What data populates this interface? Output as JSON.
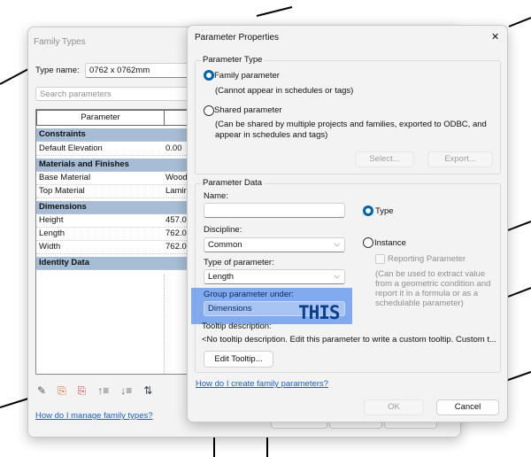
{
  "family_types": {
    "title": "Family Types",
    "type_name_label": "Type name:",
    "type_name_value": "0762 x 0762mm",
    "search_placeholder": "Search parameters",
    "column_header": "Parameter",
    "rows": [
      {
        "kind": "section",
        "label": "Constraints"
      },
      {
        "kind": "param",
        "label": "Default Elevation",
        "value": "0.00"
      },
      {
        "kind": "section",
        "label": "Materials and Finishes"
      },
      {
        "kind": "param",
        "label": "Base Material",
        "value": "Wood"
      },
      {
        "kind": "param",
        "label": "Top Material",
        "value": "Lamin"
      },
      {
        "kind": "section",
        "label": "Dimensions"
      },
      {
        "kind": "param",
        "label": "Height",
        "value": "457.00"
      },
      {
        "kind": "param",
        "label": "Length",
        "value": "762.00"
      },
      {
        "kind": "param",
        "label": "Width",
        "value": "762.00"
      },
      {
        "kind": "section",
        "label": "Identity Data"
      }
    ],
    "toolbar_icons": [
      "pencil-icon",
      "new-parameter-icon",
      "delete-parameter-icon",
      "move-up-icon",
      "move-down-icon",
      "sort-ascending-icon"
    ],
    "help_link": "How do I manage family types?"
  },
  "param_props": {
    "title": "Parameter Properties",
    "close": "✕",
    "type_group": "Parameter Type",
    "family_param": "Family parameter",
    "family_desc": "(Cannot appear in schedules or tags)",
    "shared_param": "Shared parameter",
    "shared_desc": "(Can be shared by multiple projects and families, exported to ODBC, and appear in schedules and tags)",
    "select_btn": "Select...",
    "export_btn": "Export...",
    "data_group": "Parameter Data",
    "name_label": "Name:",
    "name_value": "",
    "discipline_label": "Discipline:",
    "discipline_value": "Common",
    "type_param_label": "Type of parameter:",
    "type_param_value": "Length",
    "group_label": "Group parameter under:",
    "group_value": "Dimensions",
    "annotation": "THIS",
    "type_radio": "Type",
    "instance_radio": "Instance",
    "reporting": "Reporting Parameter",
    "reporting_desc": "(Can be used to extract value from a geometric condition and report it in a formula or as a schedulable parameter)",
    "tooltip_label": "Tooltip description:",
    "tooltip_text": "<No tooltip description. Edit this parameter to write a custom tooltip. Custom t...",
    "edit_tooltip": "Edit Tooltip...",
    "help_link": "How do I create family parameters?",
    "ok": "OK",
    "cancel": "Cancel",
    "highlight_color": "#6fa0f0"
  }
}
